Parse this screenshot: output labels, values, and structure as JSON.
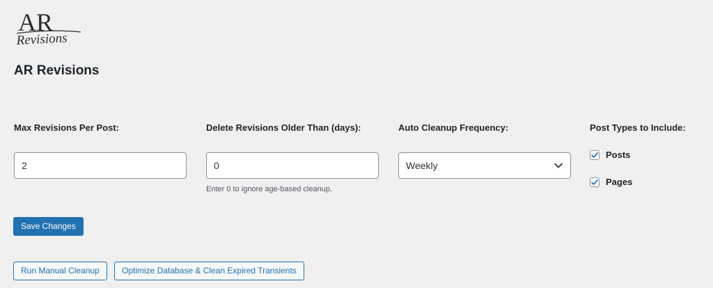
{
  "logo": {
    "initials": "AR",
    "script_text": "Revisions"
  },
  "page_title": "AR Revisions",
  "fields": {
    "max_revisions": {
      "label": "Max Revisions Per Post:",
      "value": "2"
    },
    "delete_older": {
      "label": "Delete Revisions Older Than (days):",
      "value": "0",
      "hint": "Enter 0 to ignore age-based cleanup."
    },
    "frequency": {
      "label": "Auto Cleanup Frequency:",
      "selected": "Weekly"
    },
    "post_types": {
      "label": "Post Types to Include:",
      "options": [
        {
          "label": "Posts",
          "checked": true
        },
        {
          "label": "Pages",
          "checked": true
        }
      ]
    }
  },
  "buttons": {
    "save": "Save Changes",
    "manual_cleanup": "Run Manual Cleanup",
    "optimize": "Optimize Database & Clean Expired Transients"
  },
  "colors": {
    "accent": "#2271b1",
    "background": "#f0f0f1",
    "text": "#1d2327"
  },
  "icons": {
    "select": "chevron-down-icon",
    "checkbox": "checkmark-icon"
  }
}
